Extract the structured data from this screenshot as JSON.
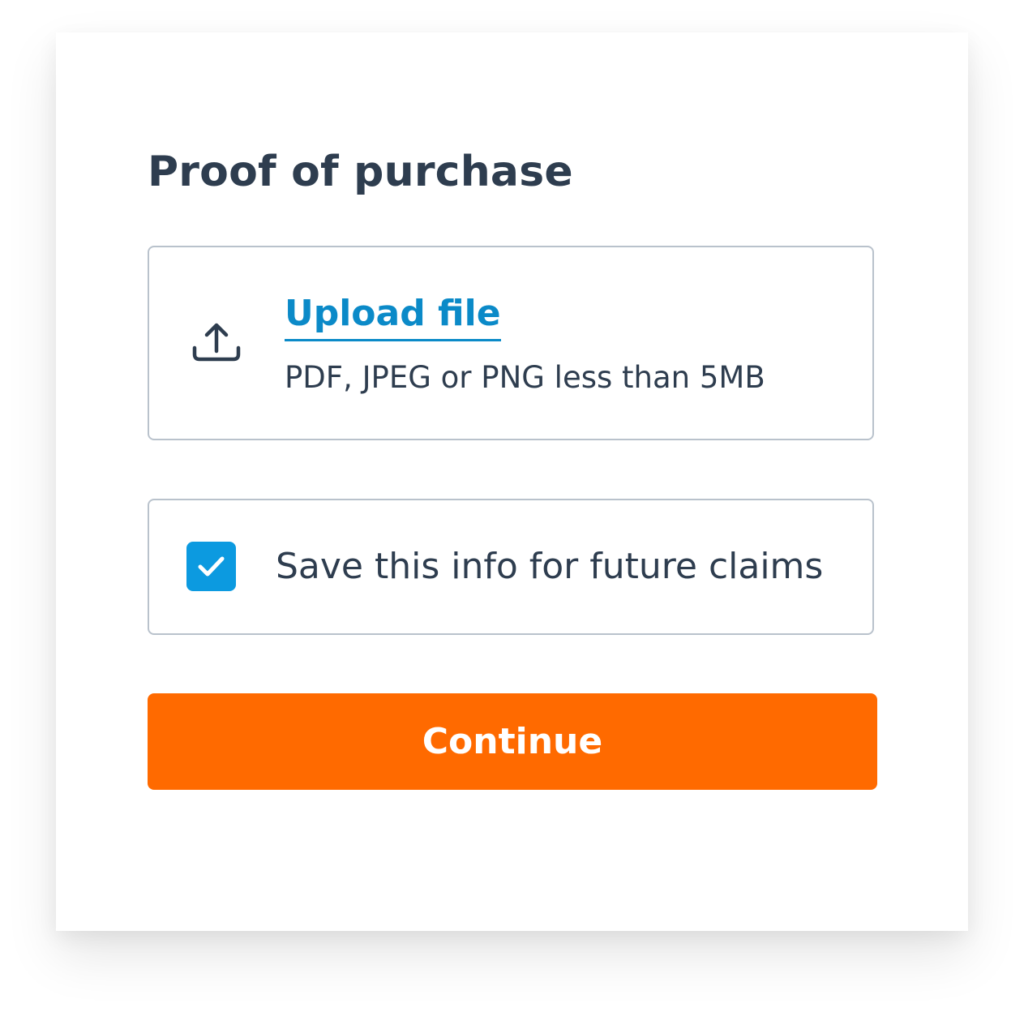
{
  "form": {
    "title": "Proof of purchase",
    "upload": {
      "link_label": "Upload file",
      "hint": "PDF, JPEG or PNG less than 5MB",
      "icon": "upload-icon"
    },
    "save_info": {
      "label": "Save this info for future claims",
      "checked": true,
      "icon": "checkmark-icon"
    },
    "continue_label": "Continue"
  },
  "colors": {
    "heading_text": "#2e3d4f",
    "link": "#0b8ac8",
    "checkbox_fill": "#0c9ae0",
    "primary_button": "#ff6a00",
    "border": "#b9c2cc"
  }
}
